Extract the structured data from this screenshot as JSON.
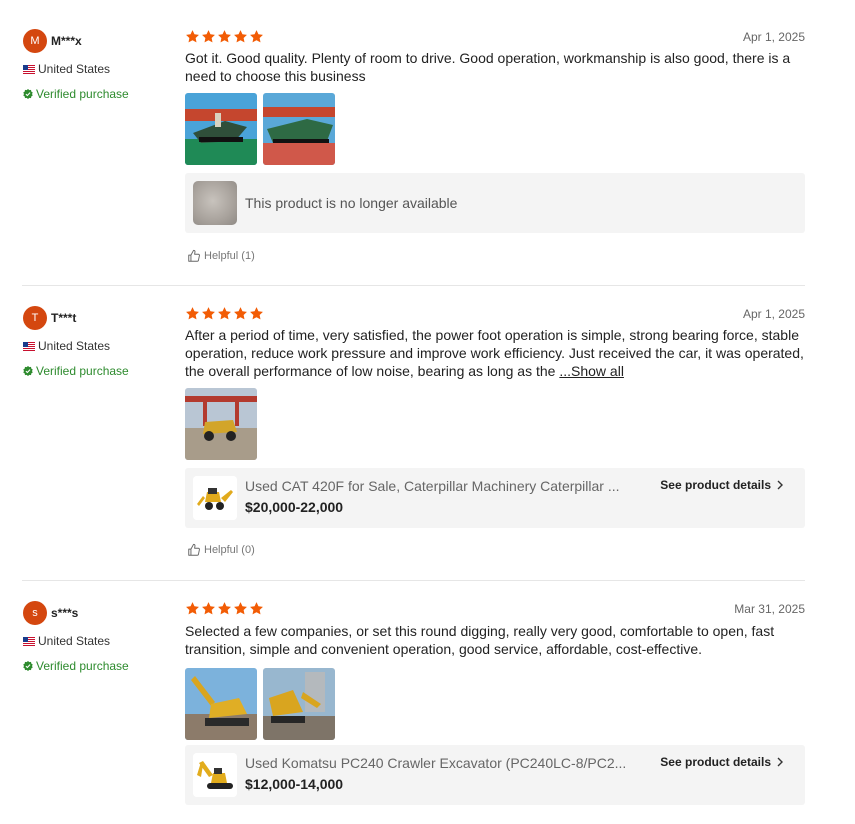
{
  "colors": {
    "star": "#f25c05",
    "avatar": "#d4470f",
    "verified": "#2e8b2e"
  },
  "reviews": [
    {
      "avatar_letter": "M",
      "username": "M***x",
      "country": "United States",
      "verified": "Verified purchase",
      "rating": 5,
      "date": "Apr 1, 2025",
      "text": "Got it. Good quality. Plenty of room to drive. Good operation, workmanship is also good, there is a need to choose this business",
      "product": {
        "unavailable_text": "This product is no longer available"
      },
      "helpful": "Helpful (1)"
    },
    {
      "avatar_letter": "T",
      "username": "T***t",
      "country": "United States",
      "verified": "Verified purchase",
      "rating": 5,
      "date": "Apr 1, 2025",
      "text": "After a period of time, very satisfied, the power foot operation is simple, strong bearing force, stable operation, reduce work pressure and improve work efficiency. Just received the car, it was operated, the overall performance of low noise, bearing as long as the ",
      "show_all": "...Show all",
      "product": {
        "title": "Used CAT 420F for Sale, Caterpillar Machinery Caterpillar ...",
        "price": "$20,000-22,000",
        "details": "See product details"
      },
      "helpful": "Helpful (0)"
    },
    {
      "avatar_letter": "s",
      "username": "s***s",
      "country": "United States",
      "verified": "Verified purchase",
      "rating": 5,
      "date": "Mar 31, 2025",
      "text": "Selected a few companies, or set this round digging, really very good, comfortable to open, fast transition, simple and convenient operation, good service, affordable, cost-effective.",
      "product": {
        "title": "Used Komatsu PC240 Crawler Excavator (PC240LC-8/PC2...",
        "price": "$12,000-14,000",
        "details": "See product details"
      }
    }
  ]
}
